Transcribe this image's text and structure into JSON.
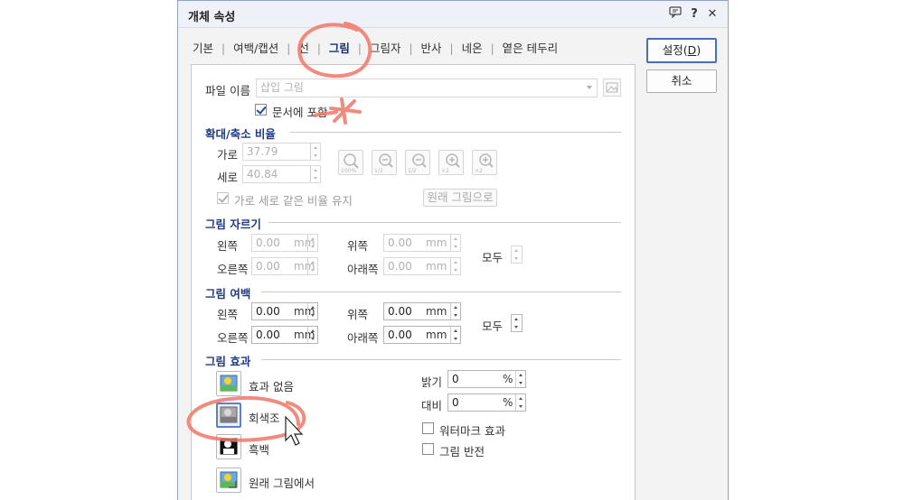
{
  "window": {
    "title": "개체 속성",
    "help_icon": "?",
    "close_icon": "✕"
  },
  "tabs": [
    "기본",
    "여백/캡션",
    "선",
    "그림",
    "그림자",
    "반사",
    "네온",
    "옅은 테두리"
  ],
  "active_tab": "그림",
  "buttons": {
    "ok": "설정(D)",
    "ok_prefix": "설정(",
    "ok_key": "D",
    "ok_suffix": ")",
    "cancel": "취소"
  },
  "file": {
    "label": "파일 이름",
    "placeholder": "삽입 그림",
    "embed_label": "문서에 포함",
    "embed_checked": true
  },
  "scale": {
    "section": "확대/축소 비율",
    "width_label": "가로",
    "width_value": "37.79",
    "height_label": "세로",
    "height_value": "40.84",
    "zoom_labels": [
      "100%",
      "1/2",
      "1/2",
      "×2",
      "×2"
    ],
    "keep_ratio_label": "가로 세로 같은 비율 유지",
    "keep_ratio_checked": true,
    "original_button": "원래 그림으로"
  },
  "crop": {
    "section": "그림 자르기",
    "left_label": "왼쪽",
    "left_value": "0.00",
    "top_label": "위쪽",
    "top_value": "0.00",
    "right_label": "오른쪽",
    "right_value": "0.00",
    "bottom_label": "아래쪽",
    "bottom_value": "0.00",
    "unit": "mm",
    "all_label": "모두"
  },
  "margin": {
    "section": "그림 여백",
    "left_label": "왼쪽",
    "left_value": "0.00",
    "top_label": "위쪽",
    "top_value": "0.00",
    "right_label": "오른쪽",
    "right_value": "0.00",
    "bottom_label": "아래쪽",
    "bottom_value": "0.00",
    "unit": "mm",
    "all_label": "모두"
  },
  "effect": {
    "section": "그림 효과",
    "options": [
      "효과 없음",
      "회색조",
      "흑백",
      "원래 그림에서"
    ],
    "selected": "회색조",
    "brightness_label": "밝기",
    "brightness_value": "0",
    "contrast_label": "대비",
    "contrast_value": "0",
    "percent": "%",
    "watermark_label": "워터마크 효과",
    "watermark_checked": false,
    "invert_label": "그림 반전",
    "invert_checked": false
  },
  "colors": {
    "accent": "#1f3b8a",
    "annotation": "#ee7766",
    "dialog_border": "#8fa3c9"
  }
}
